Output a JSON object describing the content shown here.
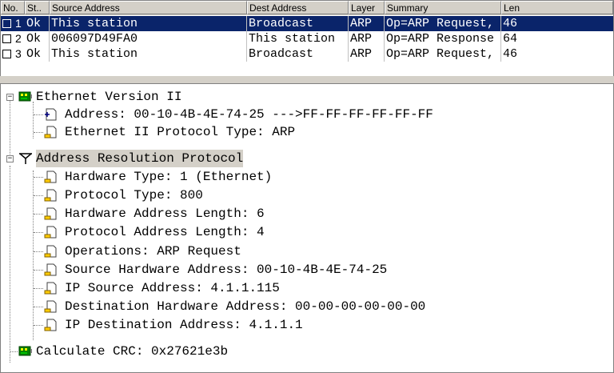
{
  "packet_list": {
    "columns": [
      "No.",
      "St..",
      "Source Address",
      "Dest Address",
      "Layer",
      "Summary",
      "Len"
    ],
    "rows": [
      {
        "no": "1",
        "st": "Ok",
        "src": "This station",
        "dst": "Broadcast",
        "layer": "ARP",
        "summary": "Op=ARP Request,",
        "len": "46",
        "selected": true
      },
      {
        "no": "2",
        "st": "Ok",
        "src": "006097D49FA0",
        "dst": "This station",
        "layer": "ARP",
        "summary": "Op=ARP Response",
        "len": "64",
        "selected": false
      },
      {
        "no": "3",
        "st": "Ok",
        "src": "This station",
        "dst": "Broadcast",
        "layer": "ARP",
        "summary": "Op=ARP Request,",
        "len": "46",
        "selected": false
      }
    ]
  },
  "detail_tree": {
    "ethernet": {
      "label": "Ethernet Version II",
      "children": [
        "Address: 00-10-4B-4E-74-25 --->FF-FF-FF-FF-FF-FF",
        "Ethernet II Protocol Type: ARP"
      ]
    },
    "arp": {
      "label": "Address Resolution Protocol",
      "children": [
        "Hardware Type: 1 (Ethernet)",
        "Protocol Type: 800",
        "Hardware Address Length: 6",
        "Protocol Address Length: 4",
        "Operations: ARP Request",
        "Source Hardware Address: 00-10-4B-4E-74-25",
        "IP Source Address: 4.1.1.115",
        "Destination Hardware Address: 00-00-00-00-00-00",
        "IP Destination Address: 4.1.1.1"
      ]
    },
    "crc": {
      "label": "Calculate CRC: 0x27621e3b"
    }
  },
  "icons": {
    "layer_icon": "network-card-icon",
    "protocol_icon": "antenna-icon",
    "field_icon": "document-icon",
    "address_icon": "link-document-icon"
  },
  "colors": {
    "selection": "#0a246a",
    "window_bg": "#d4d0c8"
  }
}
